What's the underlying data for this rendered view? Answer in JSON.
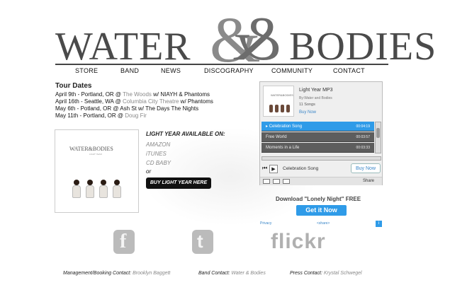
{
  "logo": {
    "left": "WATER",
    "amp": "&",
    "right": "BODIES"
  },
  "nav": [
    "STORE",
    "BAND",
    "NEWS",
    "DISCOGRAPHY",
    "COMMUNITY",
    "CONTACT"
  ],
  "tour": {
    "title": "Tour Dates",
    "lines": [
      {
        "pre": "April 9th - Portland, OR @ ",
        "venue": "The Woods",
        "post": " w/ NIAYH & Phantoms"
      },
      {
        "pre": "April 16th - Seattle, WA @ ",
        "venue": "Columbia City Theatre",
        "post": " w/ Phantoms"
      },
      {
        "pre": "May 6th - Potland, OR @ Ash St w/ The Days The Nights",
        "venue": "",
        "post": ""
      },
      {
        "pre": "May 11th - Portland, OR @ ",
        "venue": "Doug Fir",
        "post": ""
      }
    ]
  },
  "album": {
    "logo_text": "WATER&BODIES",
    "sub": "LIGHT YEAR"
  },
  "available": {
    "title": "LIGHT YEAR AVAILABLE ON:",
    "stores": [
      "AMAZON",
      "iTUNES",
      "CD BABY"
    ],
    "or": "or",
    "buy_label": "BUY LIGHT YEAR HERE"
  },
  "player": {
    "title": "Light Year MP3",
    "by": "By:Water and Bodies",
    "songs": "11 Songs",
    "buy_now": "Buy Now",
    "tracks": [
      {
        "name": "Celebration Song",
        "dur": "00:04:19",
        "active": true
      },
      {
        "name": "Free World",
        "dur": "00:03:57",
        "active": false
      },
      {
        "name": "Moments in a Life",
        "dur": "00:03:33",
        "active": false
      }
    ],
    "now_playing": "Celebration Song",
    "buy_button": "Buy Now",
    "share": "Share"
  },
  "download": {
    "text": "Download \"Lonely Night\" FREE",
    "button": "Get it Now",
    "privacy": "Privacy",
    "share": "<share>",
    "info": "i"
  },
  "social": {
    "facebook": "f",
    "twitter": "t",
    "flickr": "flickr"
  },
  "footer": [
    {
      "label": "Management/Booking Contact: ",
      "value": "Brooklyn Baggett"
    },
    {
      "label": "Band Contact: ",
      "value": "Water & Bodies"
    },
    {
      "label": "Press Contact: ",
      "value": "Krystal Schwegel"
    }
  ]
}
